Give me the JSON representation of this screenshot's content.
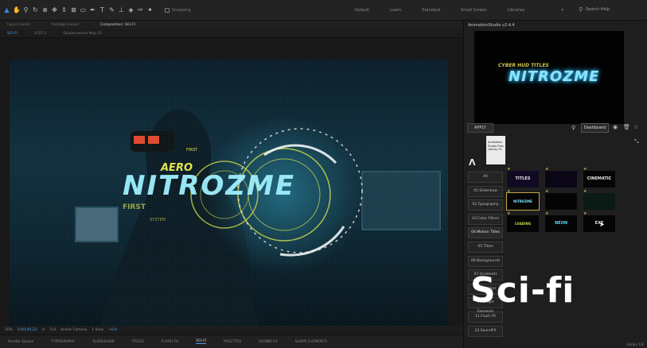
{
  "topbar": {
    "tools": [
      "selection-tool",
      "hand-tool",
      "zoom-tool",
      "rotate-tool",
      "orbit-tool",
      "pan-tool",
      "dolly-tool",
      "anchor-tool",
      "rect-tool",
      "pen-tool",
      "type-tool",
      "brush-tool",
      "clone-tool",
      "eraser-tool",
      "roto-tool",
      "puppet-tool"
    ],
    "snapping_label": "Snapping",
    "workspaces": [
      "Default",
      "Learn",
      "Standard",
      "Small Screen",
      "Libraries"
    ],
    "workspace_more": "»",
    "search_help": "Search Help"
  },
  "panel_tabs": {
    "layer": "Layer (none)",
    "footage": "Footage (none)",
    "composition": "Composition: SCI-FI"
  },
  "sub_tabs": [
    "SCI-FI",
    "SCIFI 2",
    "Displacement Map 01"
  ],
  "plugin": {
    "title": "AnimationStudio v2.4.4",
    "preview_sub": "CYBER HUD TITLES",
    "preview_main": "NITROZME",
    "apply_label": "APPLY",
    "dashboard_label": "Dashboard",
    "library_card": "Animation Studio Free Library 01",
    "categories": [
      "All",
      "01.Slideshow",
      "02.Typography",
      "03.Color Filters",
      "04.Motion Titles",
      "05.Titles",
      "06.Backgrounds",
      "07.Gradients",
      "08.Overlays",
      "09.Shape Elements",
      "11.Flash FX",
      "12.SoundFX"
    ],
    "thumbnails": [
      "TITLES",
      "",
      "CINEMATIC",
      "NITROZME",
      "",
      "",
      "LOADING",
      "NEON",
      "EXE"
    ]
  },
  "overlay_title": "Sci-fi",
  "bottom_ctrl": {
    "zoom": "50%",
    "timecode": "0:00:00:22",
    "resolution": "Full",
    "camera": "Active Camera",
    "views": "1 View",
    "exposure": "+0.0"
  },
  "bottom_tabs": [
    "Render Queue",
    "TYPOGRAPHY",
    "SLIDESHOW",
    "TITLES",
    "FLASH FX",
    "SCI-FI",
    "PALETTES",
    "SOUND FX",
    "SHAPE ELEMENTS"
  ],
  "footer_right": "Library 1/4"
}
